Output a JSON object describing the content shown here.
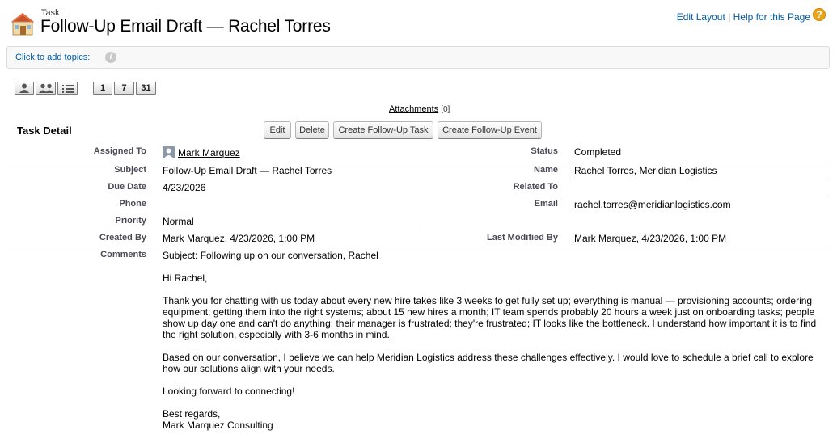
{
  "header": {
    "object_type": "Task",
    "title": "Follow-Up Email Draft — Rachel Torres",
    "edit_layout": "Edit Layout",
    "separator": "|",
    "help_link": "Help for this Page",
    "help_icon": "?"
  },
  "topics": {
    "label": "Click to add topics:",
    "info_icon": "i"
  },
  "view_buttons": {
    "day": "1",
    "week": "7",
    "month": "31"
  },
  "attachments": {
    "label": "Attachments",
    "count": "[0]"
  },
  "detail": {
    "section_title": "Task Detail",
    "buttons": {
      "edit": "Edit",
      "delete": "Delete",
      "follow_up_task": "Create Follow-Up Task",
      "follow_up_event": "Create Follow-Up Event"
    },
    "fields": {
      "assigned_to_label": "Assigned To",
      "assigned_to_value": "Mark Marquez",
      "status_label": "Status",
      "status_value": "Completed",
      "subject_label": "Subject",
      "subject_value": "Follow-Up Email Draft — Rachel Torres",
      "name_label": "Name",
      "name_value": "Rachel Torres, Meridian Logistics",
      "due_date_label": "Due Date",
      "due_date_value": "4/23/2026",
      "related_to_label": "Related To",
      "phone_label": "Phone",
      "email_label": "Email",
      "email_value": "rachel.torres@meridianlogistics.com",
      "priority_label": "Priority",
      "priority_value": "Normal",
      "created_by_label": "Created By",
      "created_by_name": "Mark Marquez",
      "created_by_date": ", 4/23/2026, 1:00 PM",
      "last_modified_label": "Last Modified By",
      "last_modified_name": "Mark Marquez",
      "last_modified_date": ", 4/23/2026, 1:00 PM",
      "comments_label": "Comments"
    },
    "comments": {
      "p1": "Subject: Following up on our conversation, Rachel",
      "p2": "Hi Rachel,",
      "p3": "Thank you for chatting with us today about every new hire takes like 3 weeks to get fully set up; everything is manual — provisioning accounts; ordering equipment; getting them into the right systems; about 15 new hires a month; IT team spends probably 20 hours a week just on onboarding tasks; people show up day one and can't do anything; their manager is frustrated; they're frustrated; IT looks like the bottleneck. I understand how important it is to find the right solution, especially with 3-6 months in mind.",
      "p4": "Based on our conversation, I believe we can help Meridian Logistics address these challenges effectively. I would love to schedule a brief call to explore how our solutions align with your needs.",
      "p5": "Looking forward to connecting!",
      "p6": "Best regards,\nMark Marquez Consulting"
    }
  },
  "colors": {
    "link_blue": "#015ba7",
    "label_gray": "#4a4a56",
    "help_orange": "#e8a317"
  },
  "icons": {
    "page_icon": "house-task-icon",
    "user_icon": "user-avatar-icon",
    "single_user_view": "single-user-icon",
    "multi_user_view": "multi-user-icon",
    "list_view": "list-icon"
  }
}
